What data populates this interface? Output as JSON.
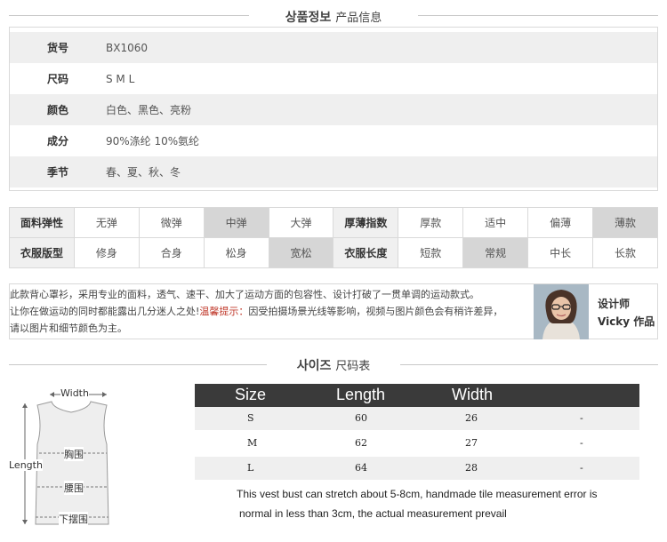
{
  "info_section": {
    "title_ko": "상품정보",
    "title_zh": "产品信息",
    "rows": [
      {
        "label": "货号",
        "value": "BX1060"
      },
      {
        "label": "尺码",
        "value": "S M L"
      },
      {
        "label": "颜色",
        "value": "白色、黑色、亮粉"
      },
      {
        "label": "成分",
        "value": "90%涤纶 10%氨纶"
      },
      {
        "label": "季节",
        "value": "春、夏、秋、冬"
      }
    ]
  },
  "attributes": {
    "row1": {
      "label_a": "面料弹性",
      "options_a": [
        "无弹",
        "微弹",
        "中弹",
        "大弹"
      ],
      "label_b": "厚薄指数",
      "options_b": [
        "厚款",
        "适中",
        "偏薄",
        "薄款"
      ]
    },
    "row2": {
      "label_a": "衣服版型",
      "options_a": [
        "修身",
        "合身",
        "松身",
        "宽松"
      ],
      "label_b": "衣服长度",
      "options_b": [
        "短款",
        "常规",
        "中长",
        "长款"
      ]
    },
    "selected": {
      "fabric_elasticity": "中弹",
      "thickness": "薄款",
      "fit": "宽松",
      "length": "常规"
    },
    "selected_color": "#d6d6d6"
  },
  "description": {
    "line1": "此款背心罩衫，采用专业的面料，透气、速干、加大了运动方面的包容性、设计打破了一贯单调的运动款式。",
    "line2_pre": "让你在做运动的同时都能露出几分迷人之处!",
    "line2_warn": "温馨提示：",
    "line2_post": "因受拍摄场景光线等影响，视频与图片颜色会有稍许差异，",
    "line3": "请以图片和细节颜色为主。",
    "warn_color": "#c0392b",
    "designer_title": "设计师",
    "designer_name": "Vicky 作品"
  },
  "size_section": {
    "title_ko": "사이즈",
    "title_zh": "尺码表",
    "diagram": {
      "width_label": "Width",
      "length_label": "Length",
      "chest_label": "胸围",
      "waist_label": "腰围",
      "hem_label": "下摆围"
    },
    "table": {
      "headers": [
        "Size",
        "Length",
        "Width"
      ],
      "rows": [
        {
          "size": "S",
          "length": "60",
          "width": "26",
          "extra": "-"
        },
        {
          "size": "M",
          "length": "62",
          "width": "27",
          "extra": "-"
        },
        {
          "size": "L",
          "length": "64",
          "width": "28",
          "extra": "-"
        }
      ]
    },
    "note_line1": "This vest bust can stretch about 5-8cm, handmade tile measurement error is",
    "note_line2": "normal in less than 3cm, the actual measurement prevail"
  }
}
